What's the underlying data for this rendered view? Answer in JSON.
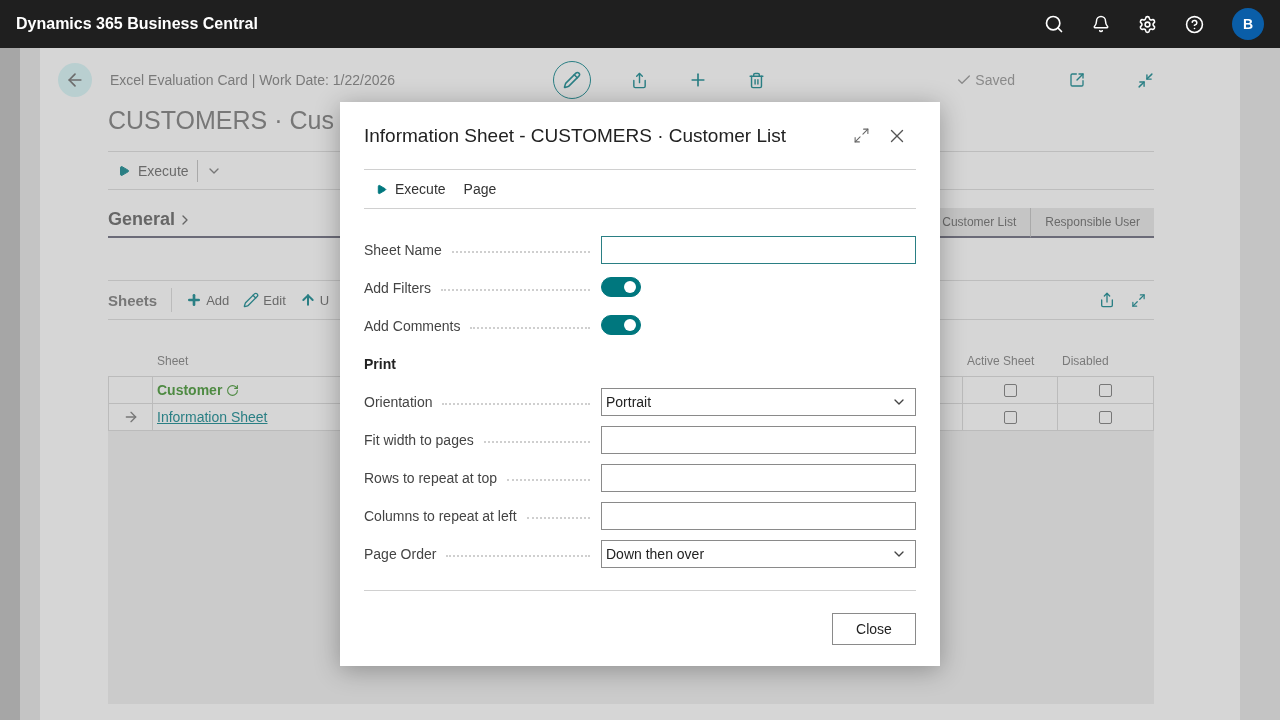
{
  "app_bar": {
    "title": "Dynamics 365 Business Central",
    "avatar": "B"
  },
  "page": {
    "breadcrumb": "Excel Evaluation Card | Work Date: 1/22/2026",
    "title": "CUSTOMERS · Cus",
    "status": "Saved",
    "action": "Execute",
    "section": "General",
    "header_tabs": [
      "Customer List",
      "Responsible User"
    ]
  },
  "sheets": {
    "title": "Sheets",
    "actions": [
      {
        "kind": "add",
        "label": "Add"
      },
      {
        "kind": "edit",
        "label": "Edit"
      },
      {
        "kind": "up",
        "label": "U"
      }
    ],
    "columns": [
      "Sheet",
      "Active Sheet",
      "Disabled"
    ],
    "rows": [
      {
        "kind": "group",
        "sheet": "Customer",
        "current": false,
        "active_sheet": false,
        "disabled": false
      },
      {
        "kind": "link",
        "sheet": "Information Sheet",
        "current": true,
        "active_sheet": false,
        "disabled": false
      }
    ]
  },
  "dialog": {
    "title": "Information Sheet - CUSTOMERS · Customer List",
    "actions": [
      {
        "kind": "run",
        "label": "Execute"
      },
      {
        "kind": "menu",
        "label": "Page"
      }
    ],
    "fields": [
      {
        "kind": "text",
        "label": "Sheet Name",
        "focused": true
      },
      {
        "kind": "toggle",
        "label": "Add Filters",
        "on": true
      },
      {
        "kind": "toggle",
        "label": "Add Comments",
        "on": true
      },
      {
        "kind": "heading",
        "label": "Print"
      },
      {
        "kind": "select",
        "label": "Orientation",
        "value": "Portrait"
      },
      {
        "kind": "text",
        "label": "Fit width to pages",
        "focused": false
      },
      {
        "kind": "text",
        "label": "Rows to repeat at top",
        "focused": false
      },
      {
        "kind": "text",
        "label": "Columns to repeat at left",
        "focused": false
      },
      {
        "kind": "select",
        "label": "Page Order",
        "value": "Down then over"
      }
    ],
    "buttons": [
      "Close"
    ]
  }
}
